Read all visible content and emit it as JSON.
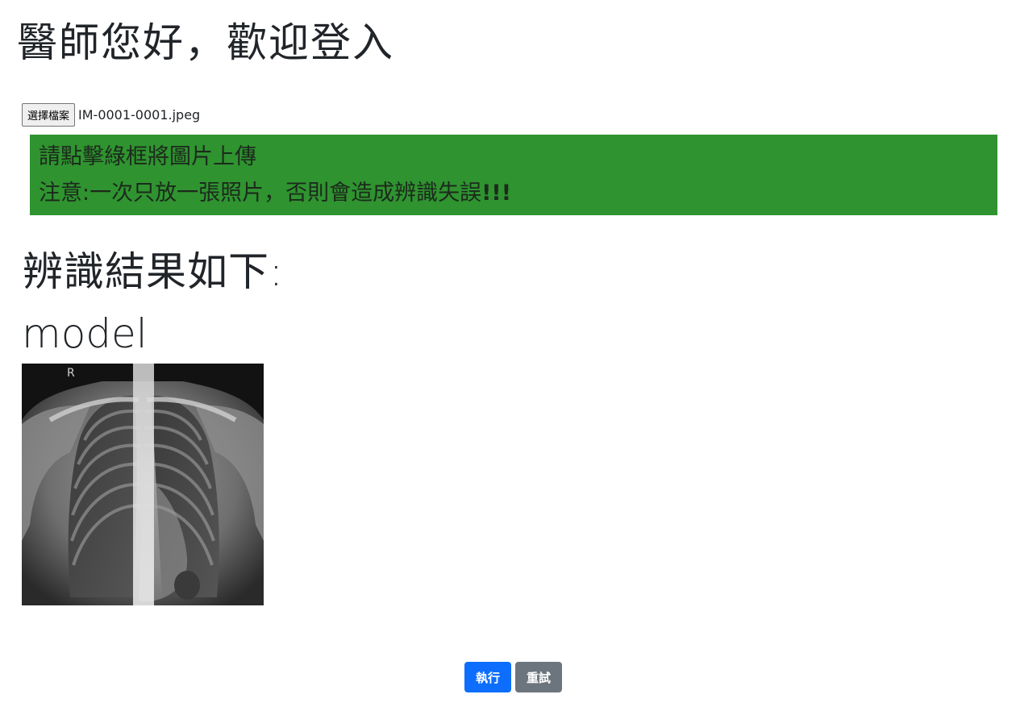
{
  "header": {
    "title": "醫師您好，歡迎登入"
  },
  "file_input": {
    "button_label": "選擇檔案",
    "file_name": "IM-0001-0001.jpeg"
  },
  "upload_area": {
    "line1": "請點擊綠框將圖片上傳",
    "line2_text": "注意:一次只放一張照片，否則會造成辨識失誤",
    "line2_emphasis": "!!!",
    "background_color": "#2f9330"
  },
  "result": {
    "heading": "辨識結果如下:",
    "model_label": "model",
    "image_marker": "R"
  },
  "actions": {
    "run_label": "執行",
    "retry_label": "重試",
    "run_color": "#0d6efd",
    "retry_color": "#6c757d"
  }
}
